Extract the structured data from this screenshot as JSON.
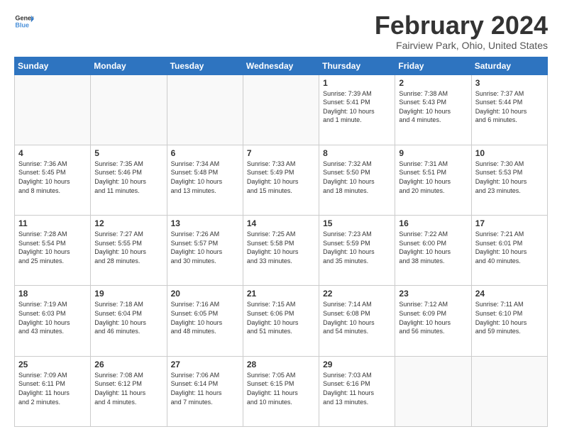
{
  "logo": {
    "line1": "General",
    "line2": "Blue"
  },
  "title": "February 2024",
  "location": "Fairview Park, Ohio, United States",
  "days_of_week": [
    "Sunday",
    "Monday",
    "Tuesday",
    "Wednesday",
    "Thursday",
    "Friday",
    "Saturday"
  ],
  "weeks": [
    [
      {
        "day": "",
        "info": ""
      },
      {
        "day": "",
        "info": ""
      },
      {
        "day": "",
        "info": ""
      },
      {
        "day": "",
        "info": ""
      },
      {
        "day": "1",
        "info": "Sunrise: 7:39 AM\nSunset: 5:41 PM\nDaylight: 10 hours\nand 1 minute."
      },
      {
        "day": "2",
        "info": "Sunrise: 7:38 AM\nSunset: 5:43 PM\nDaylight: 10 hours\nand 4 minutes."
      },
      {
        "day": "3",
        "info": "Sunrise: 7:37 AM\nSunset: 5:44 PM\nDaylight: 10 hours\nand 6 minutes."
      }
    ],
    [
      {
        "day": "4",
        "info": "Sunrise: 7:36 AM\nSunset: 5:45 PM\nDaylight: 10 hours\nand 8 minutes."
      },
      {
        "day": "5",
        "info": "Sunrise: 7:35 AM\nSunset: 5:46 PM\nDaylight: 10 hours\nand 11 minutes."
      },
      {
        "day": "6",
        "info": "Sunrise: 7:34 AM\nSunset: 5:48 PM\nDaylight: 10 hours\nand 13 minutes."
      },
      {
        "day": "7",
        "info": "Sunrise: 7:33 AM\nSunset: 5:49 PM\nDaylight: 10 hours\nand 15 minutes."
      },
      {
        "day": "8",
        "info": "Sunrise: 7:32 AM\nSunset: 5:50 PM\nDaylight: 10 hours\nand 18 minutes."
      },
      {
        "day": "9",
        "info": "Sunrise: 7:31 AM\nSunset: 5:51 PM\nDaylight: 10 hours\nand 20 minutes."
      },
      {
        "day": "10",
        "info": "Sunrise: 7:30 AM\nSunset: 5:53 PM\nDaylight: 10 hours\nand 23 minutes."
      }
    ],
    [
      {
        "day": "11",
        "info": "Sunrise: 7:28 AM\nSunset: 5:54 PM\nDaylight: 10 hours\nand 25 minutes."
      },
      {
        "day": "12",
        "info": "Sunrise: 7:27 AM\nSunset: 5:55 PM\nDaylight: 10 hours\nand 28 minutes."
      },
      {
        "day": "13",
        "info": "Sunrise: 7:26 AM\nSunset: 5:57 PM\nDaylight: 10 hours\nand 30 minutes."
      },
      {
        "day": "14",
        "info": "Sunrise: 7:25 AM\nSunset: 5:58 PM\nDaylight: 10 hours\nand 33 minutes."
      },
      {
        "day": "15",
        "info": "Sunrise: 7:23 AM\nSunset: 5:59 PM\nDaylight: 10 hours\nand 35 minutes."
      },
      {
        "day": "16",
        "info": "Sunrise: 7:22 AM\nSunset: 6:00 PM\nDaylight: 10 hours\nand 38 minutes."
      },
      {
        "day": "17",
        "info": "Sunrise: 7:21 AM\nSunset: 6:01 PM\nDaylight: 10 hours\nand 40 minutes."
      }
    ],
    [
      {
        "day": "18",
        "info": "Sunrise: 7:19 AM\nSunset: 6:03 PM\nDaylight: 10 hours\nand 43 minutes."
      },
      {
        "day": "19",
        "info": "Sunrise: 7:18 AM\nSunset: 6:04 PM\nDaylight: 10 hours\nand 46 minutes."
      },
      {
        "day": "20",
        "info": "Sunrise: 7:16 AM\nSunset: 6:05 PM\nDaylight: 10 hours\nand 48 minutes."
      },
      {
        "day": "21",
        "info": "Sunrise: 7:15 AM\nSunset: 6:06 PM\nDaylight: 10 hours\nand 51 minutes."
      },
      {
        "day": "22",
        "info": "Sunrise: 7:14 AM\nSunset: 6:08 PM\nDaylight: 10 hours\nand 54 minutes."
      },
      {
        "day": "23",
        "info": "Sunrise: 7:12 AM\nSunset: 6:09 PM\nDaylight: 10 hours\nand 56 minutes."
      },
      {
        "day": "24",
        "info": "Sunrise: 7:11 AM\nSunset: 6:10 PM\nDaylight: 10 hours\nand 59 minutes."
      }
    ],
    [
      {
        "day": "25",
        "info": "Sunrise: 7:09 AM\nSunset: 6:11 PM\nDaylight: 11 hours\nand 2 minutes."
      },
      {
        "day": "26",
        "info": "Sunrise: 7:08 AM\nSunset: 6:12 PM\nDaylight: 11 hours\nand 4 minutes."
      },
      {
        "day": "27",
        "info": "Sunrise: 7:06 AM\nSunset: 6:14 PM\nDaylight: 11 hours\nand 7 minutes."
      },
      {
        "day": "28",
        "info": "Sunrise: 7:05 AM\nSunset: 6:15 PM\nDaylight: 11 hours\nand 10 minutes."
      },
      {
        "day": "29",
        "info": "Sunrise: 7:03 AM\nSunset: 6:16 PM\nDaylight: 11 hours\nand 13 minutes."
      },
      {
        "day": "",
        "info": ""
      },
      {
        "day": "",
        "info": ""
      }
    ]
  ]
}
